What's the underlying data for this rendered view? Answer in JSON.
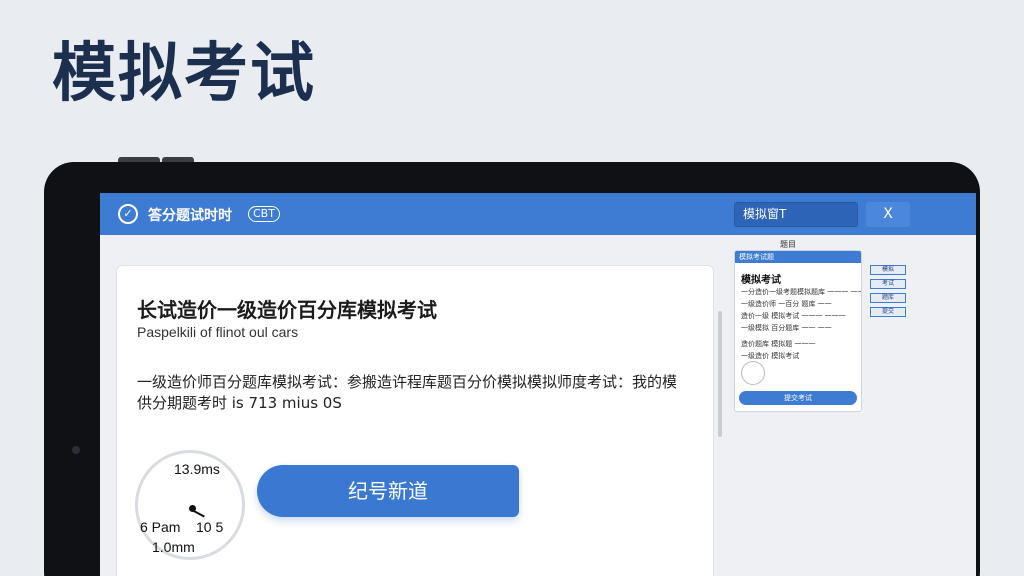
{
  "page_title": "模拟考试",
  "app": {
    "title": "答分题试时时",
    "badge": "CBT",
    "logo_icon": "exam-logo-icon"
  },
  "topbar": {
    "input_value": "模拟窗T",
    "button_label": "X"
  },
  "card": {
    "heading": "长试造价一级造价百分库模拟考试",
    "subtitle": "Paspelkili of flinot oul cars",
    "description_line1": "一级造价师百分题库模拟考试：参搬造许程库题百分价模拟模拟师度考试：我的模",
    "description_line2": "供分期题考时 is 713 mius 0S"
  },
  "clock": {
    "top": "13.9ms",
    "left": "6 Pam",
    "right": "10 5",
    "bottom": "1.0mm"
  },
  "start_button": {
    "label": "纪号新道"
  },
  "preview": {
    "label": "题目",
    "header": "模拟考试题",
    "title": "模拟考试",
    "lines": [
      "一分造价一级考题模拟题库 一一一 一一",
      "一级造价师 一百分 题库 一一",
      "造价一级 模拟考试 一一一 一一一",
      "一级模拟 百分题库 一一 一一",
      "造价题库 模拟题 一一一",
      "一级造价 模拟考试"
    ],
    "side_buttons": [
      "模拟",
      "考试",
      "题库",
      "提交"
    ],
    "bottom_button": "提交考试"
  }
}
